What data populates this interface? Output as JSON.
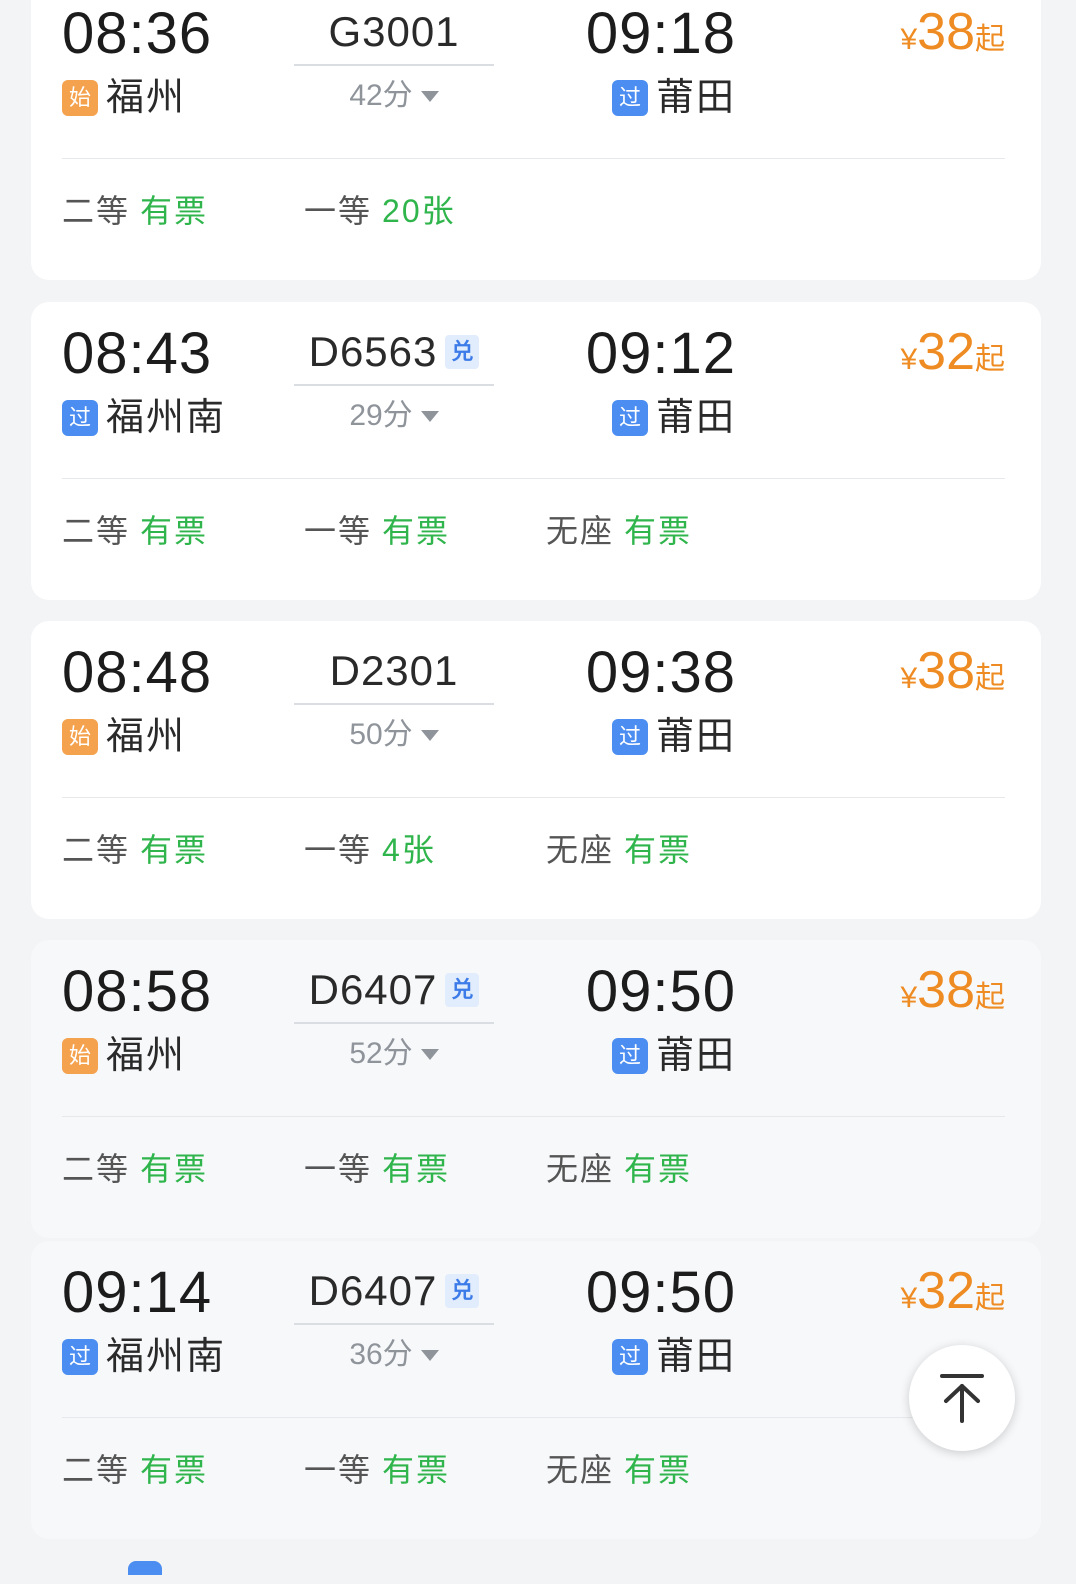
{
  "trains": [
    {
      "dep_time": "08:36",
      "dep_tag": "始",
      "dep_station": "福州",
      "train_no": "G3001",
      "exchange": "",
      "duration": "42分",
      "arr_time": "09:18",
      "arr_tag": "过",
      "arr_station": "莆田",
      "price_symbol": "¥",
      "price": "38",
      "price_suffix": "起",
      "seats": [
        {
          "class": "二等",
          "status": "有票"
        },
        {
          "class": "一等",
          "status": "20张"
        }
      ]
    },
    {
      "dep_time": "08:43",
      "dep_tag": "过",
      "dep_station": "福州南",
      "train_no": "D6563",
      "exchange": "兑",
      "duration": "29分",
      "arr_time": "09:12",
      "arr_tag": "过",
      "arr_station": "莆田",
      "price_symbol": "¥",
      "price": "32",
      "price_suffix": "起",
      "seats": [
        {
          "class": "二等",
          "status": "有票"
        },
        {
          "class": "一等",
          "status": "有票"
        },
        {
          "class": "无座",
          "status": "有票"
        }
      ]
    },
    {
      "dep_time": "08:48",
      "dep_tag": "始",
      "dep_station": "福州",
      "train_no": "D2301",
      "exchange": "",
      "duration": "50分",
      "arr_time": "09:38",
      "arr_tag": "过",
      "arr_station": "莆田",
      "price_symbol": "¥",
      "price": "38",
      "price_suffix": "起",
      "seats": [
        {
          "class": "二等",
          "status": "有票"
        },
        {
          "class": "一等",
          "status": "4张"
        },
        {
          "class": "无座",
          "status": "有票"
        }
      ]
    },
    {
      "dep_time": "08:58",
      "dep_tag": "始",
      "dep_station": "福州",
      "train_no": "D6407",
      "exchange": "兑",
      "duration": "52分",
      "arr_time": "09:50",
      "arr_tag": "过",
      "arr_station": "莆田",
      "price_symbol": "¥",
      "price": "38",
      "price_suffix": "起",
      "seats": [
        {
          "class": "二等",
          "status": "有票"
        },
        {
          "class": "一等",
          "status": "有票"
        },
        {
          "class": "无座",
          "status": "有票"
        }
      ]
    },
    {
      "dep_time": "09:14",
      "dep_tag": "过",
      "dep_station": "福州南",
      "train_no": "D6407",
      "exchange": "兑",
      "duration": "36分",
      "arr_time": "09:50",
      "arr_tag": "过",
      "arr_station": "莆田",
      "price_symbol": "¥",
      "price": "32",
      "price_suffix": "起",
      "seats": [
        {
          "class": "二等",
          "status": "有票"
        },
        {
          "class": "一等",
          "status": "有票"
        },
        {
          "class": "无座",
          "status": "有票"
        }
      ]
    }
  ],
  "colors": {
    "price": "#ee8b22",
    "available": "#2fb54c",
    "tag_start": "#f4a24e",
    "tag_pass": "#4b8df0"
  },
  "back_to_top_icon": "arrow-up-to-top-icon"
}
